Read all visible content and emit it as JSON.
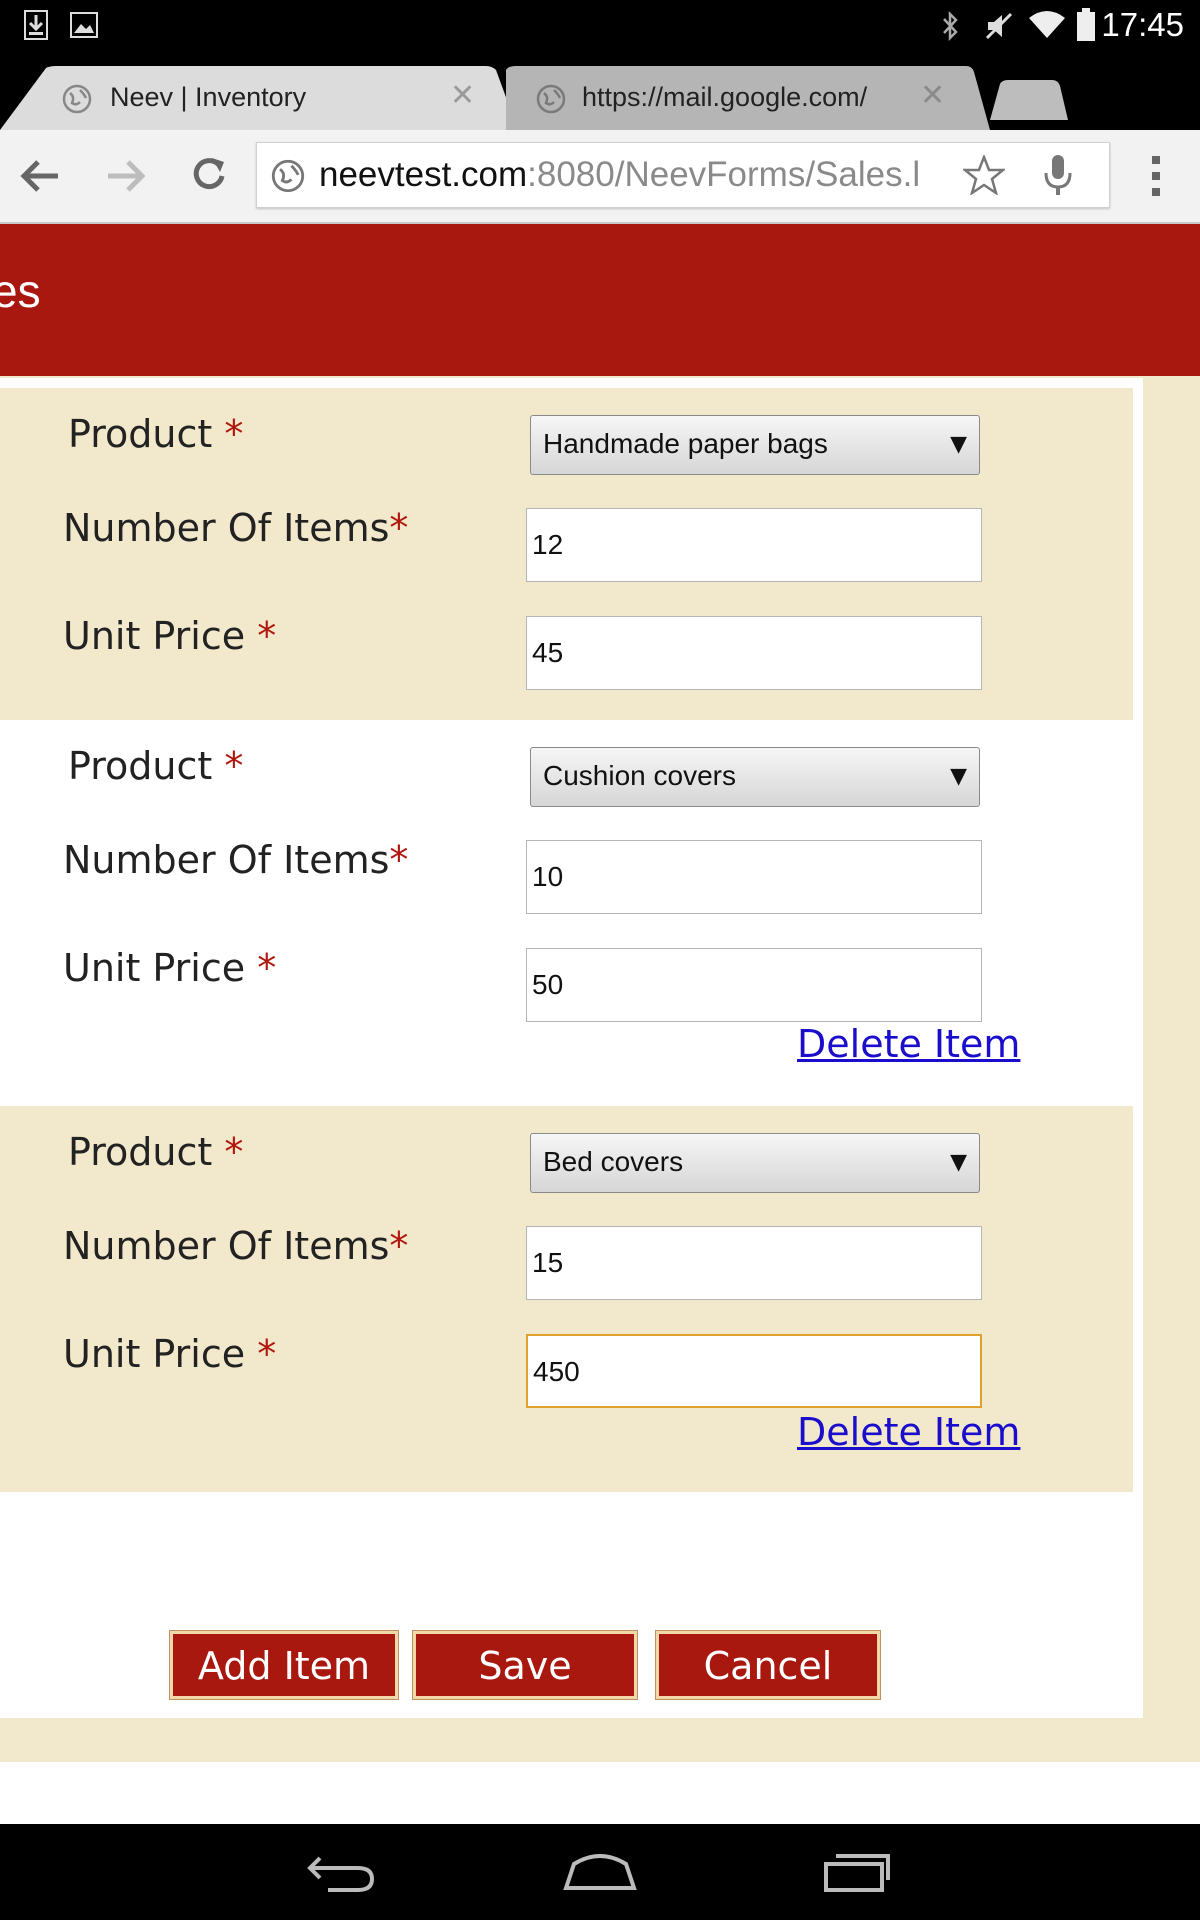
{
  "status_bar": {
    "time": "17:45",
    "icons": [
      "download-icon",
      "image-icon",
      "bluetooth-icon",
      "mute-icon",
      "wifi-icon",
      "battery-icon"
    ]
  },
  "browser": {
    "tabs": [
      {
        "title": "Neev | Inventory",
        "active": true
      },
      {
        "title": "https://mail.google.com/",
        "active": false
      }
    ],
    "url_host": "neevtest.com",
    "url_path": ":8080/NeevForms/Sales.l"
  },
  "page": {
    "header_title": "es",
    "items": [
      {
        "product_label": "Product ",
        "product_value": "Handmade paper bags",
        "qty_label": "Number Of Items",
        "qty_value": "12",
        "price_label": "Unit Price ",
        "price_value": "45",
        "required_mark": "*"
      },
      {
        "product_label": "Product ",
        "product_value": "Cushion covers",
        "qty_label": "Number Of Items",
        "qty_value": "10",
        "price_label": "Unit Price ",
        "price_value": "50",
        "required_mark": "*",
        "delete_label": "Delete Item"
      },
      {
        "product_label": "Product ",
        "product_value": "Bed covers",
        "qty_label": "Number Of Items",
        "qty_value": "15",
        "price_label": "Unit Price ",
        "price_value": "450",
        "required_mark": "*",
        "delete_label": "Delete Item"
      }
    ],
    "buttons": {
      "add_item": "Add Item",
      "save": "Save",
      "cancel": "Cancel"
    }
  },
  "colors": {
    "brand_red": "#a8180f",
    "form_tan": "#f2e8cb",
    "link_blue": "#1a0dcc",
    "focus_orange": "#e0a030"
  }
}
